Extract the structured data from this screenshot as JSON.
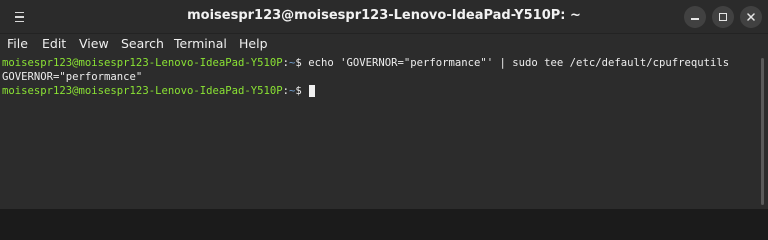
{
  "window": {
    "title": "moisespr123@moisespr123-Lenovo-IdeaPad-Y510P: ~"
  },
  "titlebar": {
    "menu_icon": "hamburger-icon",
    "buttons": [
      {
        "name": "minimize",
        "icon": "minimize-icon"
      },
      {
        "name": "maximize",
        "icon": "maximize-icon"
      },
      {
        "name": "close",
        "icon": "close-icon",
        "glyph": "✕"
      }
    ]
  },
  "menubar": {
    "items": [
      "File",
      "Edit",
      "View",
      "Search",
      "Terminal",
      "Help"
    ]
  },
  "terminal": {
    "lines": [
      {
        "user_host": "moisespr123@moisespr123-Lenovo-IdeaPad-Y510P",
        "sep": ":",
        "path": "~",
        "symbol": "$ ",
        "command": "echo 'GOVERNOR=\"performance\"' | sudo tee /etc/default/cpufrequtils"
      },
      {
        "output": "GOVERNOR=\"performance\""
      },
      {
        "user_host": "moisespr123@moisespr123-Lenovo-IdeaPad-Y510P",
        "sep": ":",
        "path": "~",
        "symbol": "$ ",
        "command": ""
      }
    ]
  },
  "colors": {
    "prompt_user": "#8ae234",
    "prompt_path": "#729fcf",
    "background": "#2c2c2c",
    "text": "#ededed"
  }
}
